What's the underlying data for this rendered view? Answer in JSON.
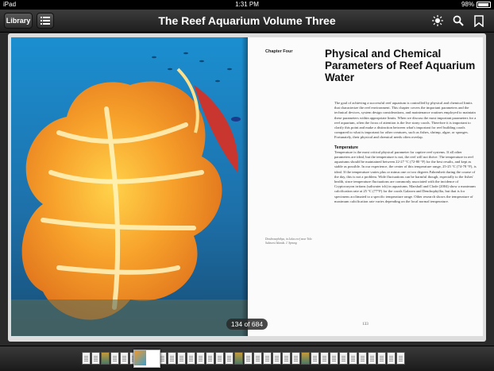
{
  "status_bar": {
    "carrier": "iPad",
    "time": "1:31 PM",
    "battery": "98%"
  },
  "toolbar": {
    "library_label": "Library",
    "title": "The Reef Aquarium Volume Three",
    "toc_icon": "list-icon",
    "brightness_icon": "brightness-icon",
    "search_icon": "search-icon",
    "bookmark_icon": "bookmark-icon"
  },
  "right_page": {
    "chapter_label": "Chapter Four",
    "heading": "Physical and Chemical Parameters of Reef Aquarium Water",
    "intro": "The goal of achieving a successful reef aquarium is controlled by physical and chemical limits that characterize the reef environment. This chapter covers the important parameters and the technical devices, system design considerations, and maintenance routines employed to maintain these parameters within appropriate limits. When we discuss the most important parameters for a reef aquarium, often the focus of attention is the live stony corals. Therefore it is important to clarify this point and make a distinction between what's important for reef building corals compared to what is important for other creatures, such as fishes, shrimp, algae, or sponges. Fortunately, their physical and chemical needs often overlap.",
    "section_heading": "Temperature",
    "section_text": "Temperature is the most critical physical parameter for captive reef systems. If all other parameters are ideal, but the temperature is not, the reef will not thrive. The temperature in reef aquariums should be maintained between 22-27 °C (72-80 °F) for the best results, and kept as stable as possible. In our experience, the center of this temperature range, 25-25 °C (74-78 °F), is ideal. If the temperature varies plus or minus one or two degrees Fahrenheit during the course of the day, this is not a problem. Wide fluctuations can be harmful though, especially to the fishes' health, since temperature fluctuations are commonly associated with the incidence of Cryptocaryon irritans (saltwater ich) in aquariums. Marshall and Clode (2004) show a maximum calcification rate at 25 °C (77°F) for the corals Galaxea and Dendrophyllia, but that is for specimens acclimated to a specific temperature range. Other research shows the temperature of maximum calcification rate varies depending on the local normal temperature.",
    "caption": "Dendronephthya, in Lolas reef near Tolo Sulawesi Islands. J. Sprung",
    "page_number": "133"
  },
  "page_counter": "134 of 684",
  "colors": {
    "toolbar": "#2b2b2b",
    "page": "#fbfbfb",
    "water": "#1f84b8",
    "coral": "#f29a2a"
  }
}
